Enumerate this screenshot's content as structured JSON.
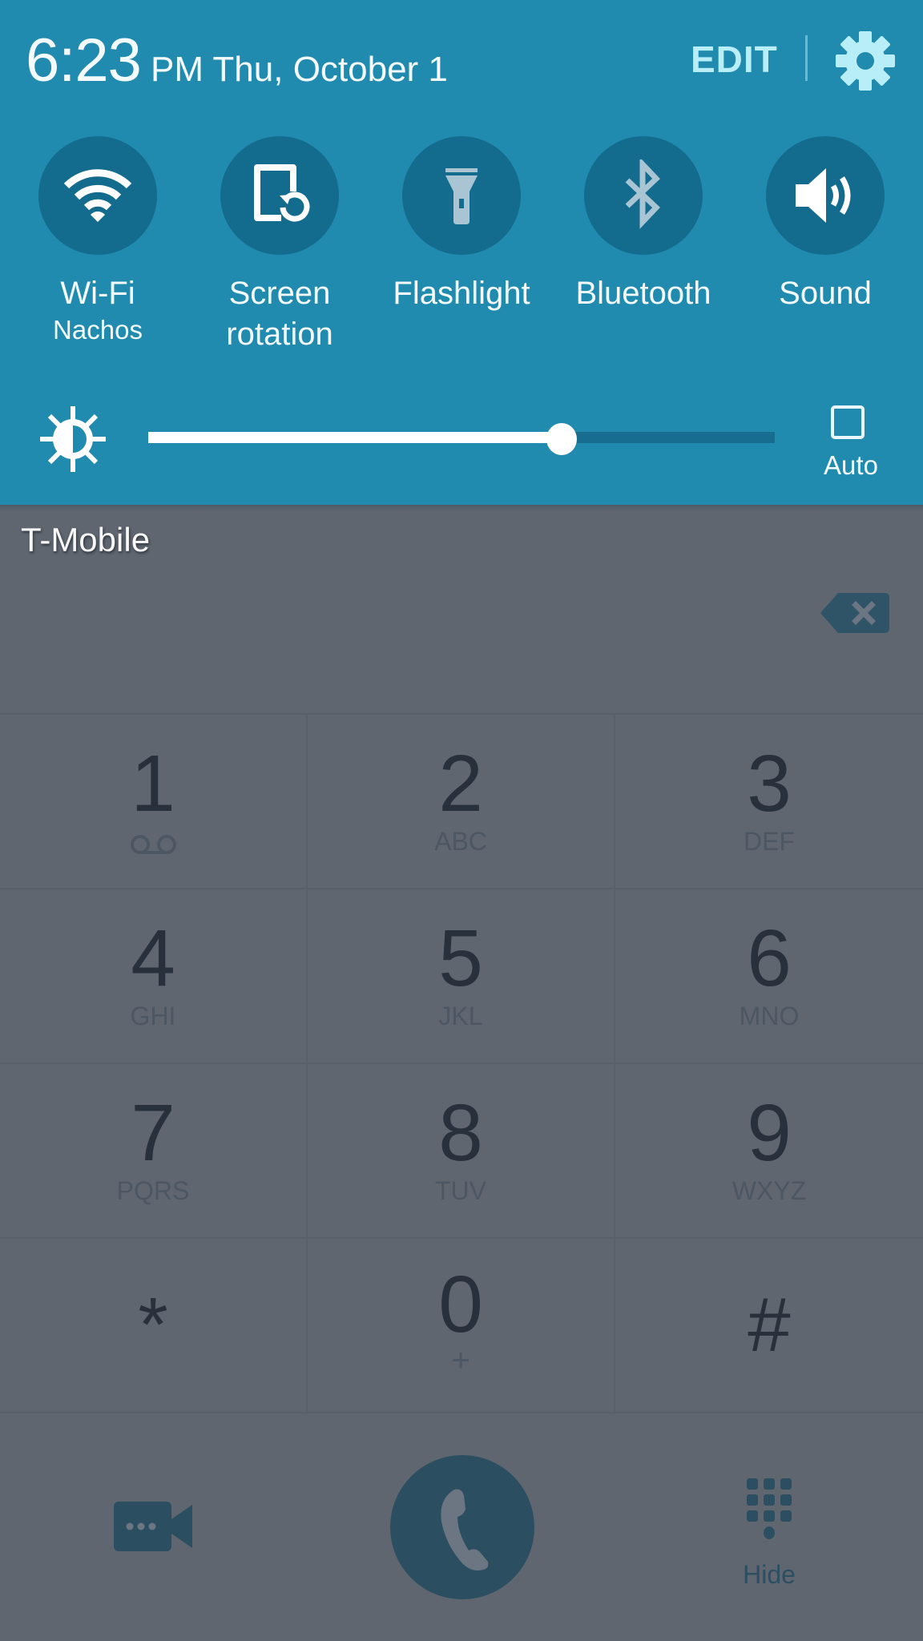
{
  "status_panel": {
    "time": "6:23",
    "ampm_date": "PM Thu, October 1",
    "edit_label": "EDIT",
    "settings_icon": "gear-icon",
    "toggles": [
      {
        "label": "Wi-Fi",
        "sublabel": "Nachos",
        "icon": "wifi-icon",
        "state": "on"
      },
      {
        "label": "Screen",
        "sublabel": "rotation",
        "icon": "screen-rotation-icon",
        "state": "on"
      },
      {
        "label": "Flashlight",
        "sublabel": "",
        "icon": "flashlight-icon",
        "state": "off"
      },
      {
        "label": "Bluetooth",
        "sublabel": "",
        "icon": "bluetooth-icon",
        "state": "off"
      },
      {
        "label": "Sound",
        "sublabel": "",
        "icon": "volume-icon",
        "state": "on"
      }
    ],
    "brightness": {
      "value_percent": 66,
      "auto_label": "Auto",
      "auto_checked": false
    },
    "colors": {
      "panel_bg": "#218aaf",
      "toggle_bg": "#136b8e",
      "accent_text": "#b7eef8"
    }
  },
  "dialer": {
    "carrier": "T-Mobile",
    "number_field": "",
    "keys": [
      {
        "digit": "1",
        "letters": "",
        "extra_icon": "voicemail-icon"
      },
      {
        "digit": "2",
        "letters": "ABC"
      },
      {
        "digit": "3",
        "letters": "DEF"
      },
      {
        "digit": "4",
        "letters": "GHI"
      },
      {
        "digit": "5",
        "letters": "JKL"
      },
      {
        "digit": "6",
        "letters": "MNO"
      },
      {
        "digit": "7",
        "letters": "PQRS"
      },
      {
        "digit": "8",
        "letters": "TUV"
      },
      {
        "digit": "9",
        "letters": "WXYZ"
      },
      {
        "digit": "*",
        "letters": ""
      },
      {
        "digit": "0",
        "letters": "+"
      },
      {
        "digit": "#",
        "letters": ""
      }
    ],
    "hide_label": "Hide",
    "colors": {
      "background": "#5f6670",
      "digit": "#27303b",
      "action": "#2b4e61"
    }
  }
}
